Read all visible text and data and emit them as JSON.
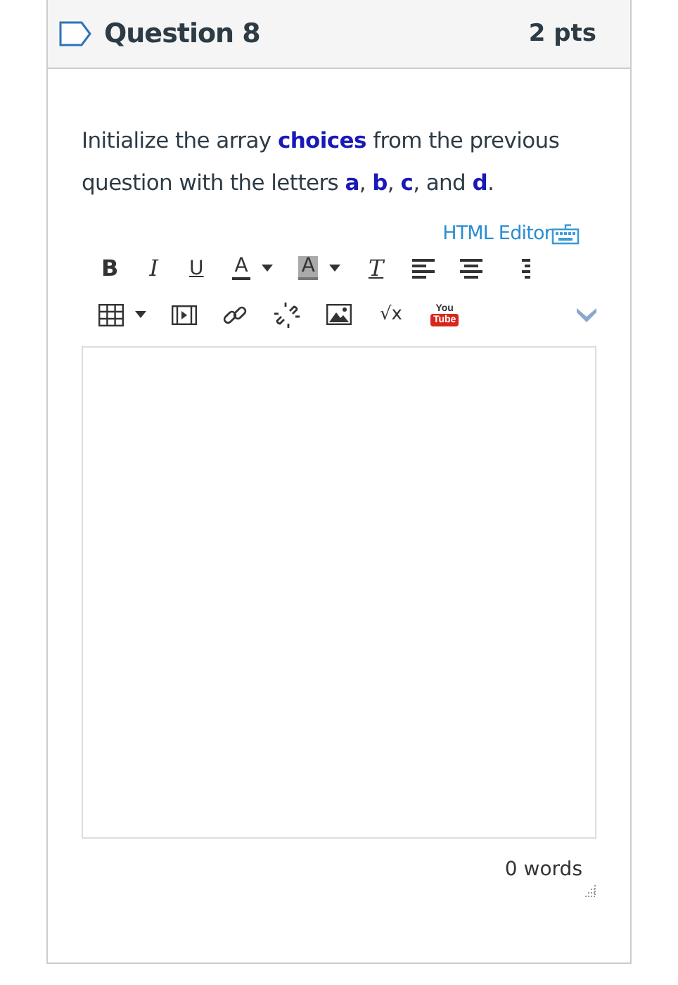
{
  "question": {
    "title": "Question 8",
    "points": "2 pts"
  },
  "prompt": "Initialize the array **choices** from the previous question with the letters **a**, **b**, **c**, and **d**.",
  "editor": {
    "html_editor_link": "HTML Editor",
    "toolbar_rows": [
      [
        {
          "kind": "bold",
          "label": "B"
        },
        {
          "kind": "italic",
          "label": "I"
        },
        {
          "kind": "underline",
          "label": "U"
        },
        {
          "kind": "color",
          "label": "A"
        },
        {
          "kind": "caret"
        },
        {
          "kind": "highlight",
          "label": "A"
        },
        {
          "kind": "caret"
        },
        {
          "kind": "clear",
          "label": "T"
        },
        {
          "kind": "align-left"
        },
        {
          "kind": "align-center"
        },
        {
          "kind": "align-right"
        }
      ],
      [
        {
          "kind": "table"
        },
        {
          "kind": "caret"
        },
        {
          "kind": "media"
        },
        {
          "kind": "link"
        },
        {
          "kind": "unlink"
        },
        {
          "kind": "image"
        },
        {
          "kind": "math",
          "label": "√x"
        },
        {
          "kind": "youtube",
          "label": "You",
          "label2": "Tube"
        },
        {
          "kind": "spacer"
        },
        {
          "kind": "more"
        }
      ]
    ],
    "word_count": "0 words"
  }
}
